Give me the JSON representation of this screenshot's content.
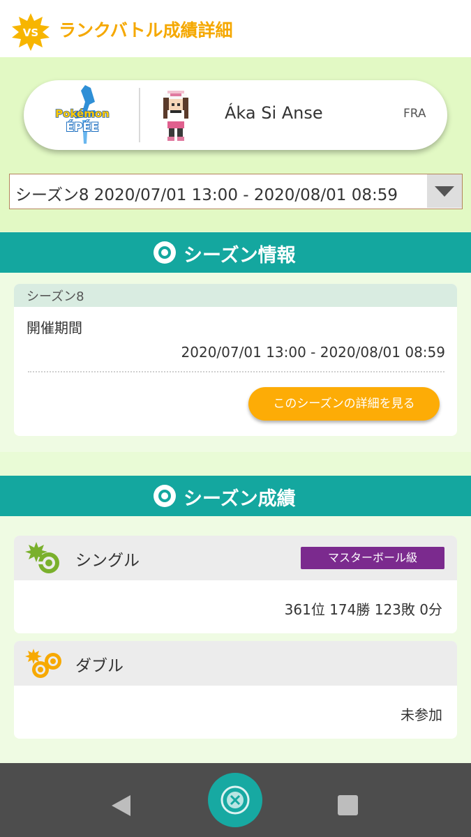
{
  "header": {
    "badge_text": "VS",
    "title": "ランクバトル成績詳細"
  },
  "player": {
    "game_logo_icon": "pokemon-epee-logo",
    "sprite_icon": "trainer-sprite",
    "name": "Áka Si Anse",
    "lang": "FRA"
  },
  "season_select": {
    "selected": "シーズン8 2020/07/01 13:00 - 2020/08/01 08:59"
  },
  "season_info": {
    "section_title": "シーズン情報",
    "season_name": "シーズン8",
    "period_label": "開催期間",
    "period_value": "2020/07/01 13:00 - 2020/08/01 08:59",
    "detail_button": "このシーズンの詳細を見る"
  },
  "season_results": {
    "section_title": "シーズン成績",
    "single": {
      "title": "シングル",
      "rank_badge": "マスターボール級",
      "value": "361位 174勝 123敗 0分"
    },
    "double": {
      "title": "ダブル",
      "value": "未参加"
    }
  },
  "colors": {
    "accent_orange": "#f5a800",
    "teal": "#14a79f",
    "master_ball_purple": "#7b2a8e",
    "button_orange": "#fdac06"
  },
  "nav": {
    "back_icon": "back-triangle-icon",
    "home_icon": "home-app-icon",
    "recents_icon": "recents-square-icon"
  }
}
